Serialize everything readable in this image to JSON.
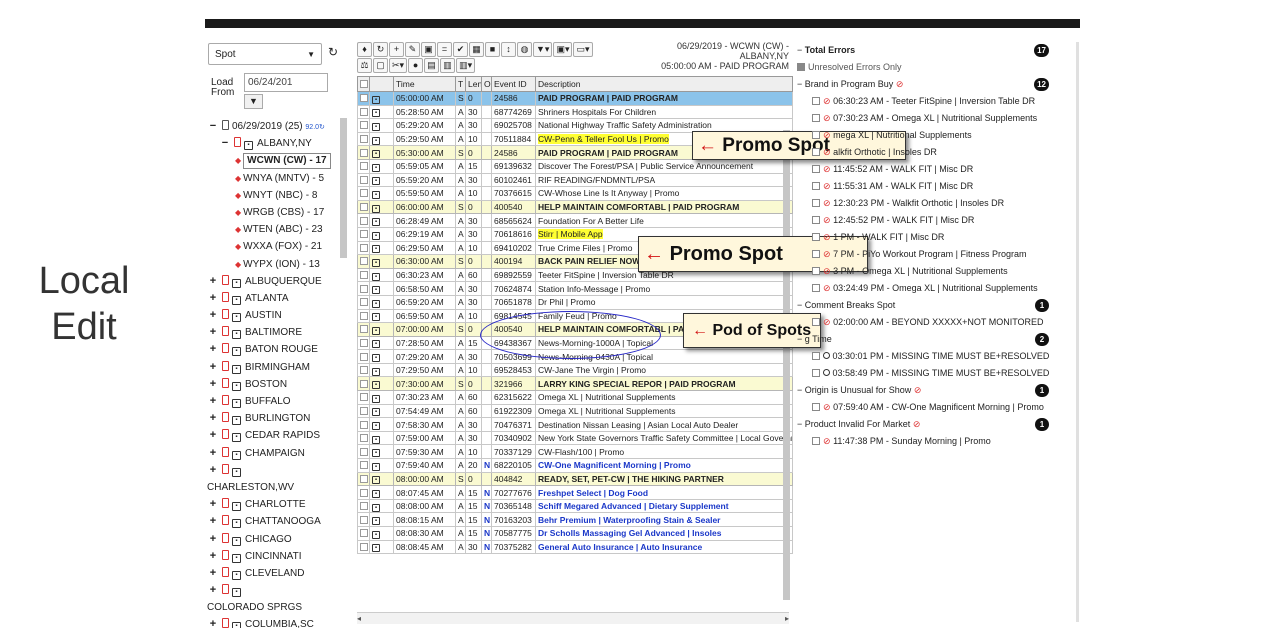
{
  "caption": {
    "line1": "Local",
    "line2": "Edit"
  },
  "left": {
    "type_select": "Spot",
    "load_label": "Load From",
    "load_date": "06/24/201",
    "date_node": "06/29/2019 (25)",
    "date_node_extra": "92.0",
    "market": "ALBANY,NY",
    "stations": [
      "WCWN (CW) - 17",
      "WNYA (MNTV) - 5",
      "WNYT (NBC) - 8",
      "WRGB (CBS) - 17",
      "WTEN (ABC) - 23",
      "WXXA (FOX) - 21",
      "WYPX (ION) - 13"
    ],
    "markets": [
      "ALBUQUERQUE",
      "ATLANTA",
      "AUSTIN",
      "BALTIMORE",
      "BATON ROUGE",
      "BIRMINGHAM",
      "BOSTON",
      "BUFFALO",
      "BURLINGTON",
      "CEDAR RAPIDS",
      "CHAMPAIGN"
    ],
    "market_charleston": "CHARLESTON,WV",
    "markets2": [
      "CHARLOTTE",
      "CHATTANOOGA",
      "CHICAGO",
      "CINCINNATI",
      "CLEVELAND"
    ],
    "market_colorado": "COLORADO SPRGS",
    "market_last": "COLUMBIA,SC"
  },
  "grid": {
    "channel_line1": "06/29/2019 - WCWN (CW) -",
    "channel_line2": "ALBANY,NY",
    "channel_line3": "05:00:00 AM - PAID PROGRAM",
    "columns": {
      "time": "Time",
      "t": "T",
      "len": "Len",
      "o": "O",
      "event": "Event ID",
      "desc": "Description"
    },
    "rows": [
      {
        "time": "05:00:00 AM",
        "t": "S",
        "len": "0",
        "o": "",
        "event": "24586",
        "desc": "PAID PROGRAM | PAID PROGRAM",
        "kind": "selected"
      },
      {
        "time": "05:28:50 AM",
        "t": "A",
        "len": "30",
        "o": "",
        "event": "68774269",
        "desc": "Shriners Hospitals For Children",
        "kind": ""
      },
      {
        "time": "05:29:20 AM",
        "t": "A",
        "len": "30",
        "o": "",
        "event": "69025708",
        "desc": "National Highway Traffic Safety Administration",
        "kind": ""
      },
      {
        "time": "05:29:50 AM",
        "t": "A",
        "len": "10",
        "o": "",
        "event": "70511884",
        "desc": "CW-Penn & Teller Fool Us | Promo",
        "kind": "hl"
      },
      {
        "time": "05:30:00 AM",
        "t": "S",
        "len": "0",
        "o": "",
        "event": "24586",
        "desc": "PAID PROGRAM | PAID PROGRAM",
        "kind": "break"
      },
      {
        "time": "05:59:05 AM",
        "t": "A",
        "len": "15",
        "o": "",
        "event": "69139632",
        "desc": "Discover The Forest/PSA | Public Service Announcement",
        "kind": ""
      },
      {
        "time": "05:59:20 AM",
        "t": "A",
        "len": "30",
        "o": "",
        "event": "60102461",
        "desc": "RIF READING/FNDMNTL/PSA",
        "kind": ""
      },
      {
        "time": "05:59:50 AM",
        "t": "A",
        "len": "10",
        "o": "",
        "event": "70376615",
        "desc": "CW-Whose Line Is It Anyway | Promo",
        "kind": ""
      },
      {
        "time": "06:00:00 AM",
        "t": "S",
        "len": "0",
        "o": "",
        "event": "400540",
        "desc": "HELP MAINTAIN COMFORTABL | PAID PROGRAM",
        "kind": "break"
      },
      {
        "time": "06:28:49 AM",
        "t": "A",
        "len": "30",
        "o": "",
        "event": "68565624",
        "desc": "Foundation For A Better Life",
        "kind": ""
      },
      {
        "time": "06:29:19 AM",
        "t": "A",
        "len": "30",
        "o": "",
        "event": "70618616",
        "desc": "Stirr | Mobile App",
        "kind": "hl"
      },
      {
        "time": "06:29:50 AM",
        "t": "A",
        "len": "10",
        "o": "",
        "event": "69410202",
        "desc": "True Crime Files | Promo",
        "kind": ""
      },
      {
        "time": "06:30:00 AM",
        "t": "S",
        "len": "0",
        "o": "",
        "event": "400194",
        "desc": "BACK PAIN RELIEF NOW! | PAID PROGRAM",
        "kind": "break"
      },
      {
        "time": "06:30:23 AM",
        "t": "A",
        "len": "60",
        "o": "",
        "event": "69892559",
        "desc": "Teeter FitSpine | Inversion Table DR",
        "kind": ""
      },
      {
        "time": "06:58:50 AM",
        "t": "A",
        "len": "30",
        "o": "",
        "event": "70624874",
        "desc": "Station Info-Message | Promo",
        "kind": ""
      },
      {
        "time": "06:59:20 AM",
        "t": "A",
        "len": "30",
        "o": "",
        "event": "70651878",
        "desc": "Dr Phil | Promo",
        "kind": ""
      },
      {
        "time": "06:59:50 AM",
        "t": "A",
        "len": "10",
        "o": "",
        "event": "69814545",
        "desc": "Family Feud | Promo",
        "kind": ""
      },
      {
        "time": "07:00:00 AM",
        "t": "S",
        "len": "0",
        "o": "",
        "event": "400540",
        "desc": "HELP MAINTAIN COMFORTABL | PAID PROGRAM",
        "kind": "break"
      },
      {
        "time": "07:28:50 AM",
        "t": "A",
        "len": "15",
        "o": "",
        "event": "69438367",
        "desc": "News-Morning-1000A | Topical",
        "kind": ""
      },
      {
        "time": "07:29:20 AM",
        "t": "A",
        "len": "30",
        "o": "",
        "event": "70503699",
        "desc": "News-Morning-0430A | Topical",
        "kind": ""
      },
      {
        "time": "07:29:50 AM",
        "t": "A",
        "len": "10",
        "o": "",
        "event": "69528453",
        "desc": "CW-Jane The Virgin | Promo",
        "kind": ""
      },
      {
        "time": "07:30:00 AM",
        "t": "S",
        "len": "0",
        "o": "",
        "event": "321966",
        "desc": "LARRY KING SPECIAL REPOR | PAID PROGRAM",
        "kind": "break"
      },
      {
        "time": "07:30:23 AM",
        "t": "A",
        "len": "60",
        "o": "",
        "event": "62315622",
        "desc": "Omega XL | Nutritional Supplements",
        "kind": ""
      },
      {
        "time": "07:54:49 AM",
        "t": "A",
        "len": "60",
        "o": "",
        "event": "61922309",
        "desc": "Omega XL | Nutritional Supplements",
        "kind": ""
      },
      {
        "time": "07:58:30 AM",
        "t": "A",
        "len": "30",
        "o": "",
        "event": "70476371",
        "desc": "Destination Nissan Leasing | Asian Local Auto Dealer",
        "kind": ""
      },
      {
        "time": "07:59:00 AM",
        "t": "A",
        "len": "30",
        "o": "",
        "event": "70340902",
        "desc": "New York State Governors Traffic Safety Committee | Local Government",
        "kind": ""
      },
      {
        "time": "07:59:30 AM",
        "t": "A",
        "len": "10",
        "o": "",
        "event": "70337129",
        "desc": "CW-Flash/100 | Promo",
        "kind": ""
      },
      {
        "time": "07:59:40 AM",
        "t": "A",
        "len": "20",
        "o": "N",
        "event": "68220105",
        "desc": "CW-One Magnificent Morning | Promo",
        "kind": "blue"
      },
      {
        "time": "08:00:00 AM",
        "t": "S",
        "len": "0",
        "o": "",
        "event": "404842",
        "desc": "READY, SET, PET-CW | THE HIKING PARTNER",
        "kind": "break"
      },
      {
        "time": "08:07:45 AM",
        "t": "A",
        "len": "15",
        "o": "N",
        "event": "70277676",
        "desc": "Freshpet Select | Dog Food",
        "kind": "blue"
      },
      {
        "time": "08:08:00 AM",
        "t": "A",
        "len": "15",
        "o": "N",
        "event": "70365148",
        "desc": "Schiff Megared Advanced | Dietary Supplement",
        "kind": "blue"
      },
      {
        "time": "08:08:15 AM",
        "t": "A",
        "len": "15",
        "o": "N",
        "event": "70163203",
        "desc": "Behr Premium | Waterproofing Stain & Sealer",
        "kind": "blue"
      },
      {
        "time": "08:08:30 AM",
        "t": "A",
        "len": "15",
        "o": "N",
        "event": "70587775",
        "desc": "Dr Scholls Massaging Gel Advanced | Insoles",
        "kind": "blue"
      },
      {
        "time": "08:08:45 AM",
        "t": "A",
        "len": "30",
        "o": "N",
        "event": "70375282",
        "desc": "General Auto Insurance | Auto Insurance",
        "kind": "blue"
      }
    ]
  },
  "annotations": {
    "promo1": "Promo Spot",
    "promo2": "Promo Spot",
    "pod": "Pod of Spots",
    "arrow": "←"
  },
  "errors": {
    "total_label": "Total Errors",
    "total_count": "17",
    "unresolved_label": "Unresolved Errors Only",
    "brand_label": "Brand in Program Buy",
    "brand_count": "12",
    "brand_items": [
      "06:30:23 AM - Teeter FitSpine | Inversion Table DR",
      "07:30:23 AM - Omega XL | Nutritional Supplements",
      "mega XL | Nutritional Supplements",
      "alkfit Orthotic | Insoles DR",
      "11:45:52 AM - WALK FIT | Misc DR",
      "11:55:31 AM - WALK FIT | Misc DR",
      "12:30:23 PM - Walkfit Orthotic | Insoles DR",
      "12:45:52 PM - WALK FIT | Misc DR",
      "1 PM - WALK FIT | Misc DR",
      "7 PM - PiYo Workout Program | Fitness Program",
      "3 PM - Omega XL | Nutritional Supplements",
      "03:24:49 PM - Omega XL | Nutritional Supplements"
    ],
    "comment_label": "Comment Breaks Spot",
    "comment_count": "1",
    "comment_items": [
      "02:00:00 AM - BEYOND XXXXX+NOT MONITORED"
    ],
    "timing_label": "g Time",
    "timing_count": "2",
    "timing_items": [
      "03:30:01 PM - MISSING TIME MUST BE+RESOLVED",
      "03:58:49 PM - MISSING TIME MUST BE+RESOLVED"
    ],
    "origin_label": "Origin is Unusual for Show",
    "origin_count": "1",
    "origin_items": [
      "07:59:40 AM - CW-One Magnificent Morning | Promo"
    ],
    "product_label": "Product Invalid For Market",
    "product_count": "1",
    "product_items": [
      "11:47:38 PM - Sunday Morning | Promo"
    ]
  }
}
